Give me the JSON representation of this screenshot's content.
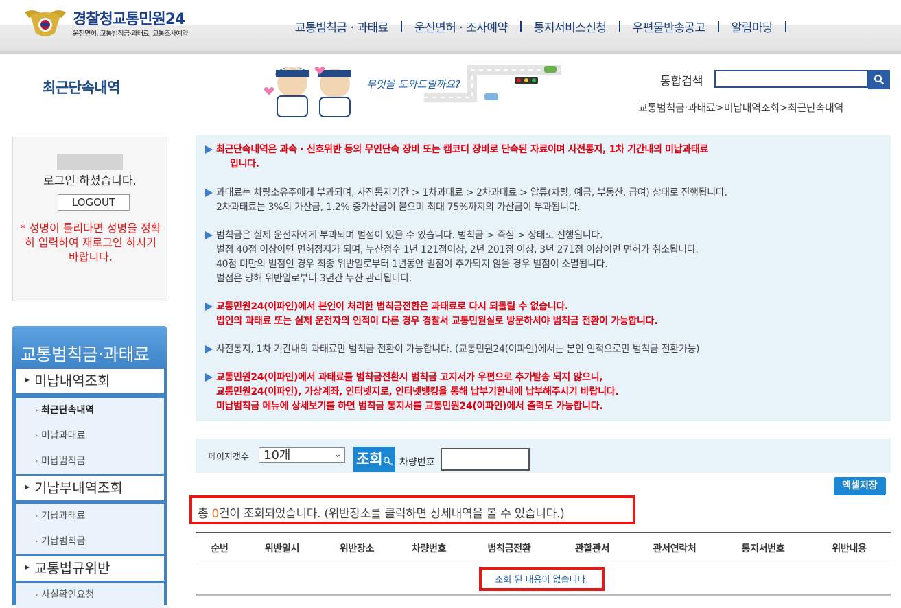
{
  "header": {
    "logo_title_first": "경찰청",
    "logo_title_second": "교통민원24",
    "logo_subtitle": "운전면허, 교통범칙금·과태료, 교통조사예약",
    "nav": [
      "교통범칙금 · 과태료",
      "운전면허 · 조사예약",
      "통지서비스신청",
      "우편물반송공고",
      "알림마당"
    ]
  },
  "page_title": "최근단속내역",
  "banner_text": "무엇을 도와드릴까요?",
  "search": {
    "label": "통합검색",
    "value": ""
  },
  "breadcrumb": "교통범칙금·과태료>미납내역조회>최근단속내역",
  "login": {
    "message": "로그인 하셨습니다.",
    "logout_label": "LOGOUT",
    "warning": "* 성명이 틀리다면 성명을 정확히 입력하여 재로그인 하시기 바랍니다."
  },
  "sidebar": {
    "title": "교통범칙금·과태료",
    "sections": [
      {
        "label": "미납내역조회",
        "items": [
          "최근단속내역",
          "미납과태료",
          "미납범칙금"
        ]
      },
      {
        "label": "기납부내역조회",
        "items": [
          "기납과태료",
          "기납범칙금"
        ]
      },
      {
        "label": "교통법규위반",
        "items": [
          "사실확인요청"
        ]
      }
    ],
    "active_item": "최근단속내역"
  },
  "notices": [
    {
      "style": "red",
      "lines": [
        "최근단속내역은 과속 · 신호위반 등의 무인단속 장비 또는 캠코더 장비로 단속된 자료이며 사전통지, 1차 기간내의 미납과태료",
        "입니다."
      ]
    },
    {
      "style": "normal",
      "lines": [
        "과태료는 차량소유주에게 부과되며, 사진통지기간 > 1차과태료 > 2차과태료 > 압류(차량, 예금, 부동산, 급여) 상태로 진행됩니다.",
        "2차과태료는 3%의 가산금, 1.2% 중가산금이 붙으며 최대 75%까지의 가산금이 부과됩니다."
      ]
    },
    {
      "style": "normal",
      "lines": [
        "범칙금은 실제 운전자에게 부과되며 벌점이 있을 수 있습니다. 범칙금 > 즉심 > 상태로 진행됩니다.",
        "벌점 40점 이상이면 면허정지가 되며, 누산점수 1년 121점이상, 2년 201점 이상, 3년 271점 이상이면 면허가 취소됩니다.",
        "40점 미만의 벌점인 경우 최종 위반일로부터 1년동안 벌점이 추가되지 않을 경우 벌점이 소멸됩니다.",
        "벌점은 당해 위반일로부터 3년간 누산 관리됩니다."
      ]
    },
    {
      "style": "red",
      "lines": [
        "교통민원24(이파인)에서 본인이 처리한 범칙금전환은 과태료로 다시 되돌릴 수 없습니다.",
        "법인의 과태료 또는 실제 운전자의 인적이 다른 경우 경찰서 교통민원실로 방문하셔야 범칙금 전환이 가능합니다."
      ]
    },
    {
      "style": "normal",
      "lines": [
        "사전통지, 1차 기간내의 과태료만 범칙금 전환이 가능합니다. (교통민원24(이파인)에서는 본인 인적으로만 범칙금 전환가능)"
      ]
    },
    {
      "style": "red",
      "lines": [
        "교통민원24(이파인)에서 과태료를 범칙금전환시 범칙금 고지서가 우편으로 추가발송 되지 않으니,",
        "교통민원24(이파인), 가상계좌, 인터넷지로, 인터넷뱅킹을 통해 납부기한내에 납부해주시기 바랍니다.",
        "미납범칙금 메뉴에 상세보기를 하면 범칙금 통지서를 교통민원24(이파인)에서 출력도 가능합니다."
      ]
    }
  ],
  "filter": {
    "pagesize_label": "페이지갯수",
    "pagesize_value": "10개",
    "query_label": "조회",
    "plate_label": "차량번호",
    "plate_value": ""
  },
  "excel_label": "엑셀저장",
  "result": {
    "prefix": "총 ",
    "count": "0",
    "suffix": "건이 조회되었습니다. (위반장소를 클릭하면 상세내역을 볼 수 있습니다.)"
  },
  "table": {
    "headers": [
      "순번",
      "위반일시",
      "위반장소",
      "차량번호",
      "범칙금전환",
      "관할관서",
      "관서연락처",
      "통지서번호",
      "위반내용"
    ],
    "empty_message": "조회 된 내용이 없습니다."
  },
  "colors": {
    "primary": "#1b87d3",
    "brand_navy": "#1a3f8c",
    "alert_red": "#e3000f",
    "count_orange": "#f36f21"
  }
}
